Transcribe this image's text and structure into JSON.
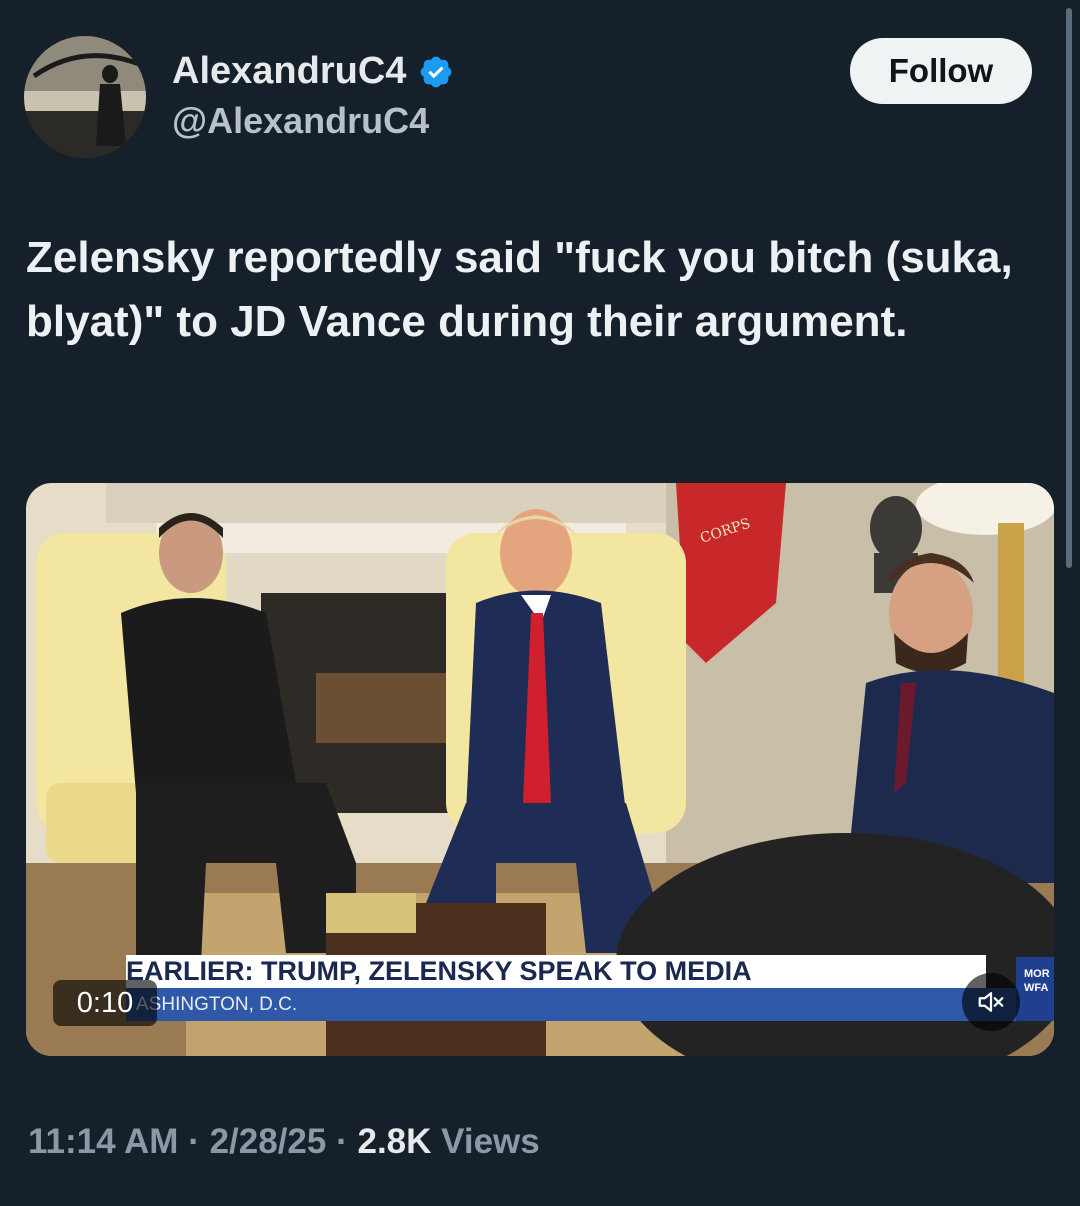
{
  "author": {
    "display_name": "AlexandruC4",
    "handle": "@AlexandruC4",
    "verified": true,
    "follow_label": "Follow"
  },
  "tweet": {
    "text": "Zelensky reportedly said \"fuck you bitch (suka, blyat)\" to JD Vance during their argument."
  },
  "media": {
    "type": "video",
    "duration": "0:10",
    "chyron_headline": "EARLIER: TRUMP, ZELENSKY SPEAK TO MEDIA",
    "chyron_location": "ASHINGTON, D.C.",
    "side_tag_top": "MOR",
    "side_tag_bottom": "WFA",
    "flag_text": "CORPS"
  },
  "footer": {
    "time": "11:14 AM",
    "separator": "·",
    "date": "2/28/25",
    "views_count": "2.8K",
    "views_label": "Views"
  },
  "colors": {
    "background": "#15202b",
    "verified_blue": "#1d9bf0",
    "chyron_blue": "#2f59a8"
  }
}
